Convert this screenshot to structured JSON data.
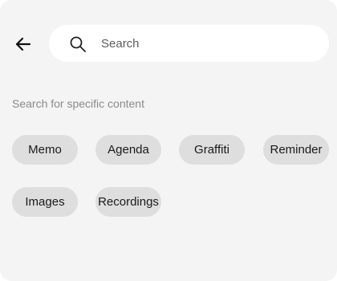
{
  "header": {
    "back_icon": "arrow-left-icon"
  },
  "search": {
    "icon": "search-icon",
    "placeholder": "Search",
    "value": ""
  },
  "section": {
    "label": "Search for specific content"
  },
  "chips": [
    {
      "label": "Memo"
    },
    {
      "label": "Agenda"
    },
    {
      "label": "Graffiti"
    },
    {
      "label": "Reminder"
    },
    {
      "label": "Images"
    },
    {
      "label": "Recordings"
    }
  ],
  "colors": {
    "background": "#f4f4f4",
    "search_bg": "#ffffff",
    "chip_bg": "#dedede",
    "label_text": "#8a8a8a",
    "chip_text": "#1a1a1a"
  }
}
